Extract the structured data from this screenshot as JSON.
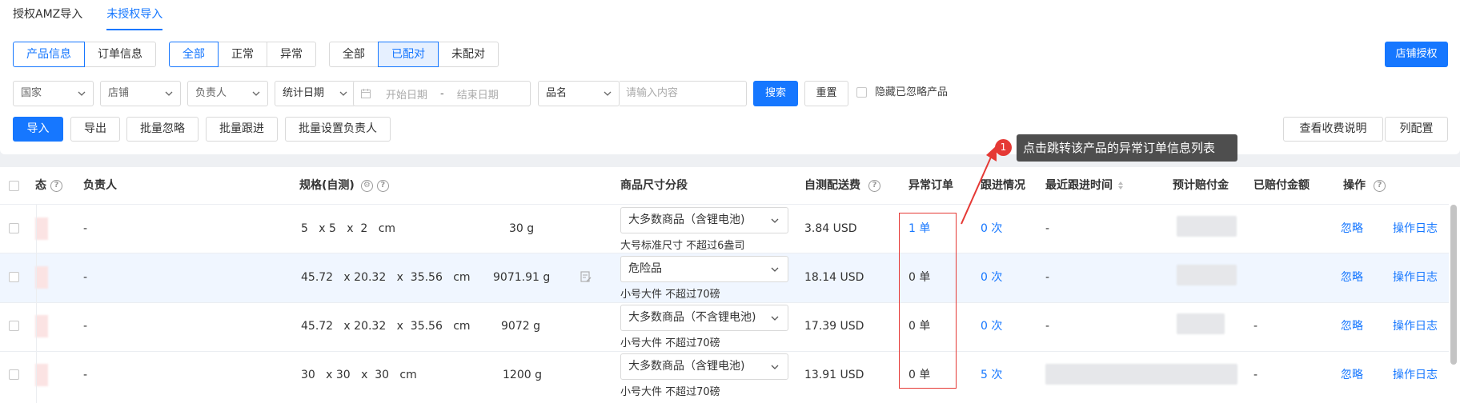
{
  "tabs": [
    "授权AMZ导入",
    "未授权导入"
  ],
  "info_segment": [
    "产品信息",
    "订单信息"
  ],
  "status_segment": [
    "全部",
    "正常",
    "异常"
  ],
  "match_segment": [
    "全部",
    "已配对",
    "未配对"
  ],
  "store_auth_button": "店铺授权",
  "filters": {
    "country": "国家",
    "store": "店铺",
    "owner": "负责人",
    "date_type": "统计日期",
    "start_date": "开始日期",
    "date_sep": "-",
    "end_date": "结束日期",
    "name_type": "品名",
    "search_placeholder": "请输入内容",
    "search": "搜索",
    "reset": "重置",
    "hide_ignored": "隐藏已忽略产品"
  },
  "actions": {
    "import": "导入",
    "export": "导出",
    "bulk_ignore": "批量忽略",
    "bulk_follow": "批量跟进",
    "bulk_owner": "批量设置负责人",
    "fee_info": "查看收费说明",
    "column_config": "列配置"
  },
  "tooltip": {
    "badge": "1",
    "text": "点击跳转该产品的异常订单信息列表"
  },
  "headers": {
    "status": "态",
    "owner": "负责人",
    "spec": "规格(自测)",
    "size_tier": "商品尺寸分段",
    "fee": "自测配送费",
    "abnormal": "异常订单",
    "follow": "跟进情况",
    "last_follow": "最近跟进时间",
    "est_comp": "预计赔付金",
    "paid": "已赔付金额",
    "ops": "操作"
  },
  "rows": [
    {
      "owner": "-",
      "dims": "5   x 5   x  2   cm",
      "weight": "30 g",
      "tier": "大多数商品（含锂电池)",
      "tier_sub": "大号标准尺寸 不超过6盎司",
      "fee": "3.84 USD",
      "abnormal": "1 单",
      "follow": "0 次",
      "last": "-",
      "paid": "",
      "ignore": "忽略",
      "log": "操作日志"
    },
    {
      "owner": "-",
      "dims": "45.72   x 20.32   x  35.56   cm",
      "weight": "9071.91 g",
      "tier": "危险品",
      "tier_sub": "小号大件 不超过70磅",
      "fee": "18.14 USD",
      "abnormal": "0 单",
      "follow": "0 次",
      "last": "-",
      "paid": "",
      "ignore": "忽略",
      "log": "操作日志"
    },
    {
      "owner": "-",
      "dims": "45.72   x 20.32   x  35.56   cm",
      "weight": "9072 g",
      "tier": "大多数商品（不含锂电池)",
      "tier_sub": "小号大件 不超过70磅",
      "fee": "17.39 USD",
      "abnormal": "0 单",
      "follow": "0 次",
      "last": "-",
      "paid": "-",
      "ignore": "忽略",
      "log": "操作日志"
    },
    {
      "owner": "-",
      "dims": "30   x 30   x  30   cm",
      "weight": "1200 g",
      "tier": "大多数商品（含锂电池)",
      "tier_sub": "小号大件 不超过70磅",
      "fee": "13.91 USD",
      "abnormal": "0 单",
      "follow": "5 次",
      "last": "",
      "paid": "-",
      "ignore": "忽略",
      "log": "操作日志"
    }
  ]
}
